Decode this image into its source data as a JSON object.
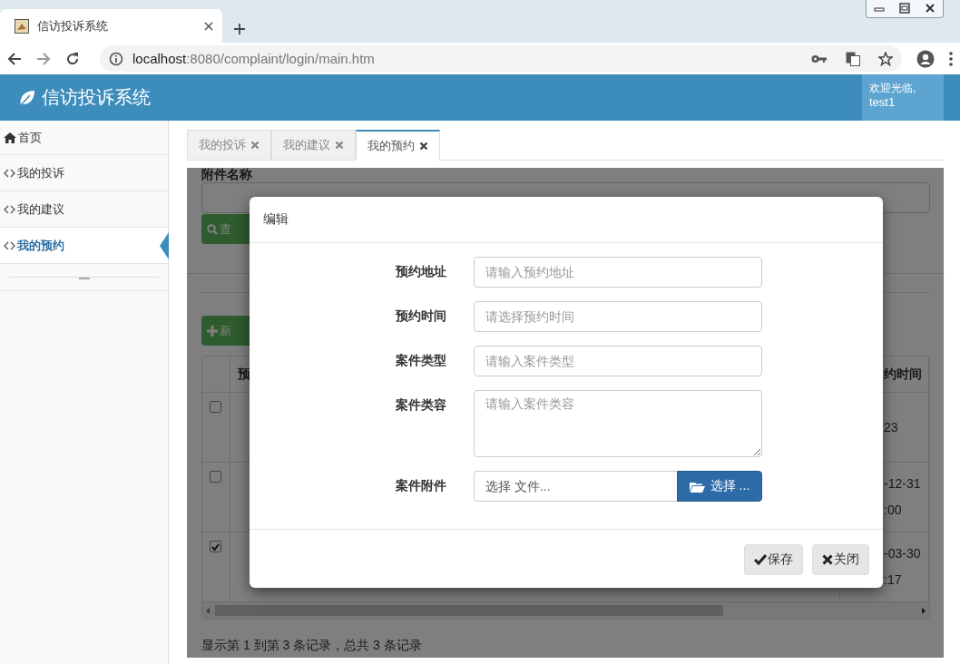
{
  "browser": {
    "tab_title": "信访投诉系统",
    "url_host": "localhost",
    "url_path": ":8080/complaint/login/main.htm"
  },
  "app": {
    "title": "信访投诉系统",
    "welcome": "欢迎光临,",
    "user": "test1"
  },
  "sidebar": {
    "items": [
      {
        "label": "首页",
        "kind": "home",
        "selected": false
      },
      {
        "label": "我的投诉",
        "kind": "link",
        "selected": false
      },
      {
        "label": "我的建议",
        "kind": "link",
        "selected": false
      },
      {
        "label": "我的预约",
        "kind": "link",
        "selected": true
      }
    ]
  },
  "tabs": [
    {
      "label": "我的投诉",
      "selected": false
    },
    {
      "label": "我的建议",
      "selected": false
    },
    {
      "label": "我的预约",
      "selected": true
    }
  ],
  "page": {
    "search_label": "附件名称",
    "search_button": "查",
    "add_button": "新",
    "table": {
      "columns": [
        "预",
        "约时间"
      ],
      "rows": [
        {
          "checked": false,
          "column_3": [
            "23"
          ]
        },
        {
          "checked": false,
          "column_3": [
            "-12-31",
            ":00"
          ]
        },
        {
          "checked": true,
          "column_3": [
            "-03-30",
            ":17"
          ]
        }
      ]
    },
    "footer": "显示第 1 到第 3 条记录，总共 3 条记录"
  },
  "dialog": {
    "title": "编辑",
    "fields": [
      {
        "label": "预约地址",
        "kind": "text",
        "placeholder": "请输入预约地址"
      },
      {
        "label": "预约时间",
        "kind": "text",
        "placeholder": "请选择预约时间"
      },
      {
        "label": "案件类型",
        "kind": "text",
        "placeholder": "请输入案件类型"
      },
      {
        "label": "案件类容",
        "kind": "textarea",
        "placeholder": "请输入案件类容"
      },
      {
        "label": "案件附件",
        "kind": "file",
        "placeholder": "选择 文件...",
        "button": "选择 ..."
      }
    ],
    "buttons": [
      {
        "label": "保存",
        "kind": "save"
      },
      {
        "label": "关闭",
        "kind": "close"
      }
    ]
  }
}
